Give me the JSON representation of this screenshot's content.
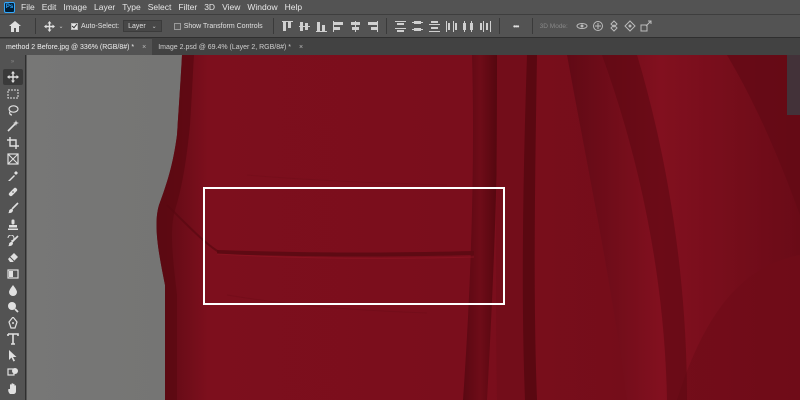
{
  "menu": {
    "app_badge": "Ps",
    "items": [
      "File",
      "Edit",
      "Image",
      "Layer",
      "Type",
      "Select",
      "Filter",
      "3D",
      "View",
      "Window",
      "Help"
    ]
  },
  "options": {
    "auto_select_label": "Auto-Select:",
    "auto_select_value": "Layer",
    "show_transform_label": "Show Transform Controls",
    "more_label": "•••",
    "mode_label": "3D Mode:"
  },
  "tabs": [
    {
      "label": "method 2 Before.jpg @ 336% (RGB/8#) *",
      "close": "×"
    },
    {
      "label": "Image 2.psd @ 69.4% (Layer 2, RGB/8#) *",
      "close": "×"
    }
  ],
  "tools": [
    {
      "name": "move-tool-icon"
    },
    {
      "name": "marquee-tool-icon"
    },
    {
      "name": "lasso-tool-icon"
    },
    {
      "name": "magic-wand-tool-icon"
    },
    {
      "name": "crop-tool-icon"
    },
    {
      "name": "frame-tool-icon"
    },
    {
      "name": "eyedropper-tool-icon"
    },
    {
      "name": "healing-brush-tool-icon"
    },
    {
      "name": "brush-tool-icon"
    },
    {
      "name": "clone-stamp-tool-icon"
    },
    {
      "name": "history-brush-tool-icon"
    },
    {
      "name": "eraser-tool-icon"
    },
    {
      "name": "gradient-tool-icon"
    },
    {
      "name": "blur-tool-icon"
    },
    {
      "name": "dodge-tool-icon"
    },
    {
      "name": "pen-tool-icon"
    },
    {
      "name": "type-tool-icon"
    },
    {
      "name": "path-selection-tool-icon"
    },
    {
      "name": "shape-tool-icon"
    },
    {
      "name": "hand-tool-icon"
    }
  ],
  "colors": {
    "accent": "#31a8ff",
    "fabric": "#7a0f1c",
    "background_wall": "#747474"
  }
}
